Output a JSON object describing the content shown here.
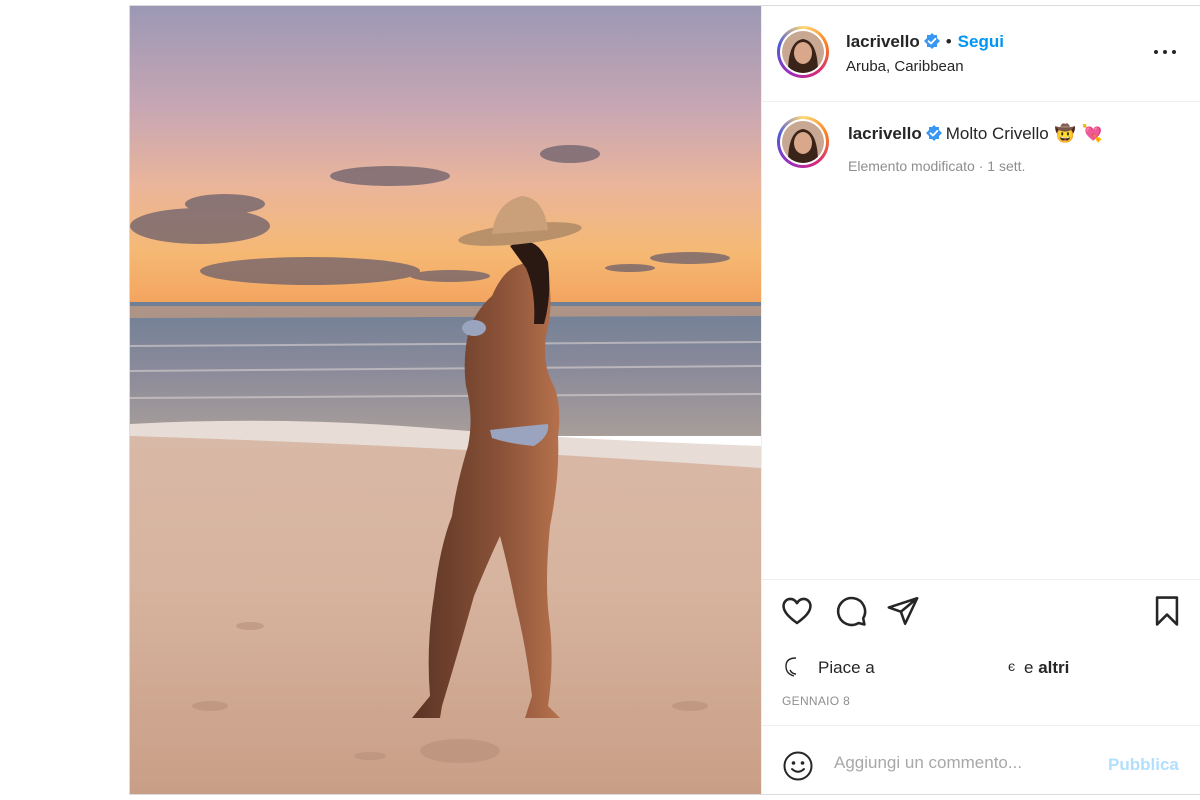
{
  "post": {
    "username": "lacrivello",
    "verified": true,
    "follow_separator": "•",
    "follow_label": "Segui",
    "location": "Aruba, Caribbean",
    "more_icon": "more-horizontal-icon"
  },
  "caption": {
    "username": "lacrivello",
    "text": "Molto Crivello",
    "emojis": [
      "🤠",
      "💘"
    ],
    "meta": "Elemento modificato · 1 sett."
  },
  "actions": {
    "icons": [
      "heart-icon",
      "comment-icon",
      "share-icon",
      "bookmark-icon"
    ],
    "likes_prefix": "Piace a",
    "likes_char": "є",
    "likes_and": "e",
    "likes_others": "altri",
    "date": "GENNAIO 8"
  },
  "comment": {
    "placeholder": "Aggiungi un commento...",
    "post_label": "Pubblica"
  },
  "colors": {
    "accent": "#0095f6",
    "post_disabled": "#b2dffc",
    "muted": "#8e8e8e",
    "verified": "#3897f0"
  }
}
